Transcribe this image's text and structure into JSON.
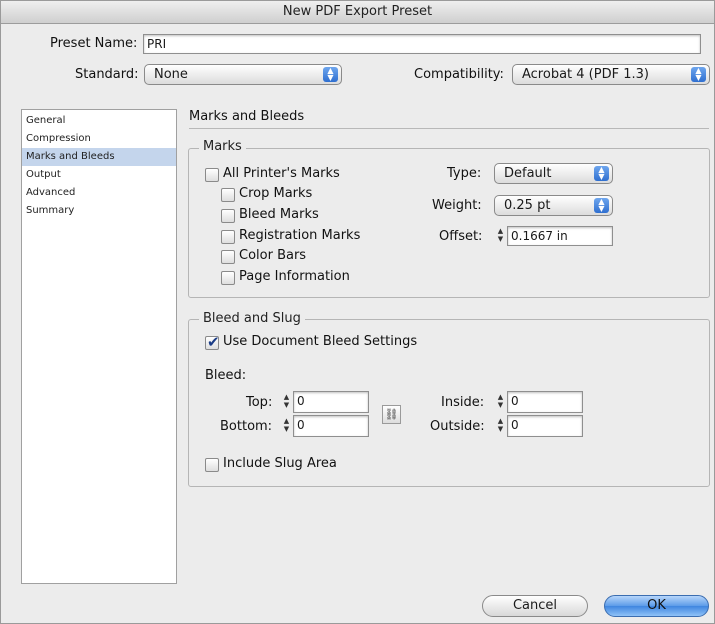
{
  "window": {
    "title": "New PDF Export Preset"
  },
  "preset": {
    "label": "Preset Name:",
    "value": "PRI"
  },
  "standard": {
    "label": "Standard:",
    "value": "None"
  },
  "compatibility": {
    "label": "Compatibility:",
    "value": "Acrobat 4 (PDF 1.3)"
  },
  "sidebar": {
    "items": [
      "General",
      "Compression",
      "Marks and Bleeds",
      "Output",
      "Advanced",
      "Summary"
    ],
    "selected": "Marks and Bleeds"
  },
  "section": {
    "title": "Marks and Bleeds"
  },
  "marks": {
    "title": "Marks",
    "all_printers_marks": "All Printer's Marks",
    "crop_marks": "Crop Marks",
    "bleed_marks": "Bleed Marks",
    "registration_marks": "Registration Marks",
    "color_bars": "Color Bars",
    "page_information": "Page Information",
    "type_label": "Type:",
    "type_value": "Default",
    "weight_label": "Weight:",
    "weight_value": "0.25 pt",
    "offset_label": "Offset:",
    "offset_value": "0.1667 in"
  },
  "bleed": {
    "title": "Bleed and Slug",
    "use_doc_settings": "Use Document Bleed Settings",
    "use_doc_settings_checked": true,
    "bleed_label": "Bleed:",
    "top_label": "Top:",
    "top_value": "0",
    "bottom_label": "Bottom:",
    "bottom_value": "0",
    "inside_label": "Inside:",
    "inside_value": "0",
    "outside_label": "Outside:",
    "outside_value": "0",
    "include_slug": "Include Slug Area"
  },
  "buttons": {
    "cancel": "Cancel",
    "ok": "OK"
  },
  "colors": {
    "accent": "#3f86e0",
    "selection": "#c4d5ec"
  }
}
